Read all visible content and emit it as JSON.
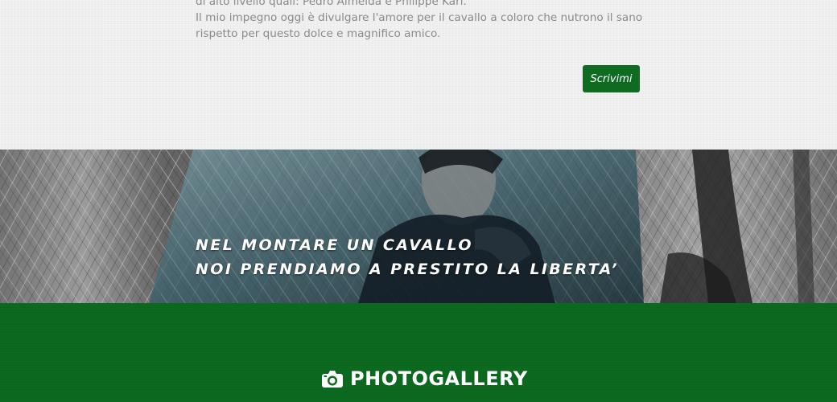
{
  "intro": {
    "lines": [
      "di alto livello quali: Pedro Almeida e Philippe Karl.",
      "Il mio impegno oggi è divulgare l'amore per il cavallo a coloro che nutrono il sano",
      "rispetto per questo dolce e magnifico amico."
    ],
    "button_label": "Scrivimi"
  },
  "banner": {
    "quote_lines": [
      "NEL MONTARE UN CAVALLO",
      "NOI PRENDIAMO A PRESTITO LA LIBERTA’"
    ]
  },
  "gallery": {
    "title": "PHOTOGALLERY",
    "icon": "camera-icon"
  },
  "colors": {
    "brand_green": "#0e6b20",
    "section_green": "#0b6a1f",
    "intro_text": "#8a8a8a",
    "intro_bg": "#efefef"
  }
}
